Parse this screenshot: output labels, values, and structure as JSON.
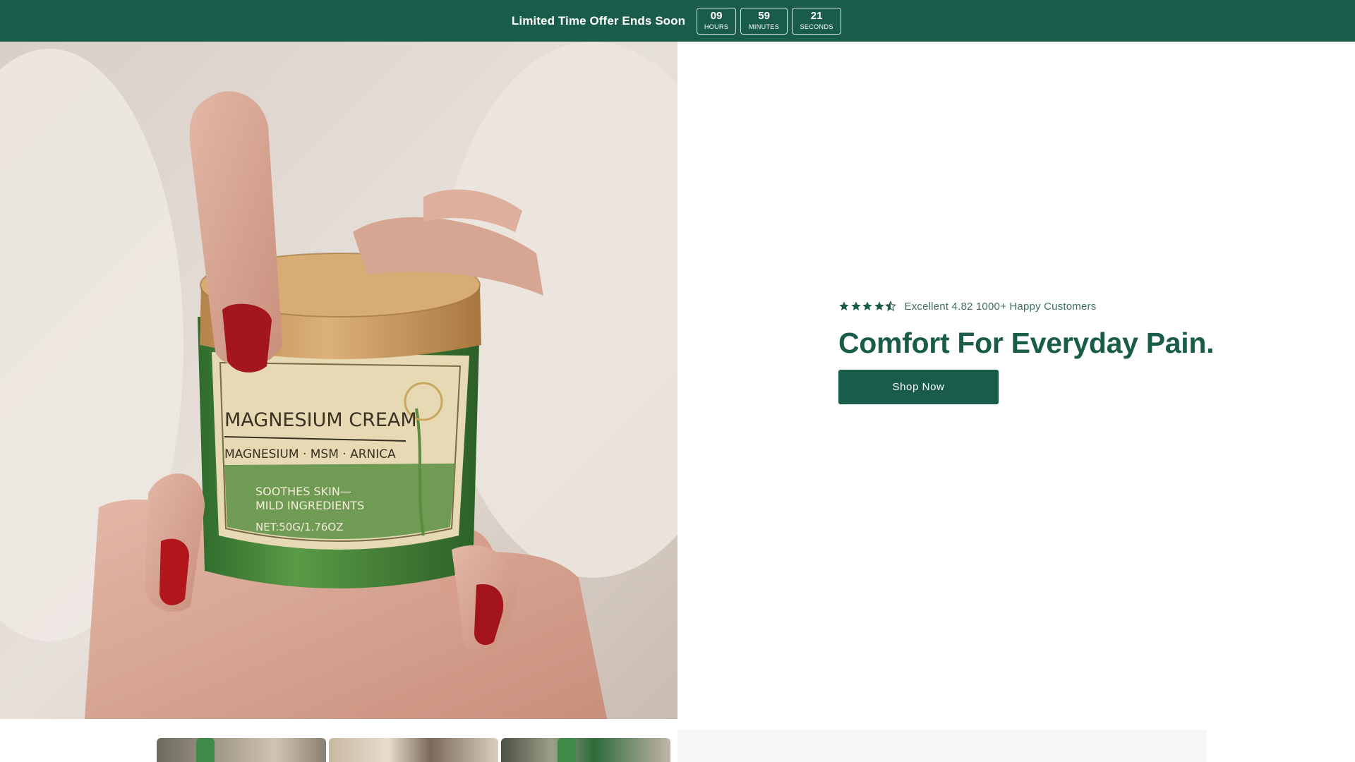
{
  "announcement": {
    "text": "Limited Time Offer Ends Soon",
    "countdown": [
      {
        "value": "09",
        "unit": "HOURS"
      },
      {
        "value": "59",
        "unit": "MINUTES"
      },
      {
        "value": "21",
        "unit": "SECONDS"
      }
    ]
  },
  "hero": {
    "rating": {
      "stars": 4.5,
      "text": "Excellent 4.82 1000+ Happy Customers"
    },
    "headline": "Comfort For Everyday Pain.",
    "cta_label": "Shop Now",
    "product_label": {
      "title": "MAGNESIUM CREAM",
      "ingredients": "MAGNESIUM · MSM · ARNICA",
      "line1": "SOOTHES SKIN—",
      "line2": "MILD INGREDIENTS",
      "net": "NET:50G/1.76OZ"
    }
  },
  "colors": {
    "brand": "#1a5c4a",
    "rating_text": "#3d6f60",
    "jar_green": "#3f7d3a",
    "label_green": "#6f9b55",
    "lid_wood": "#c89a5b"
  },
  "icons": {
    "star": "star-icon",
    "half_star": "star-half-icon"
  }
}
